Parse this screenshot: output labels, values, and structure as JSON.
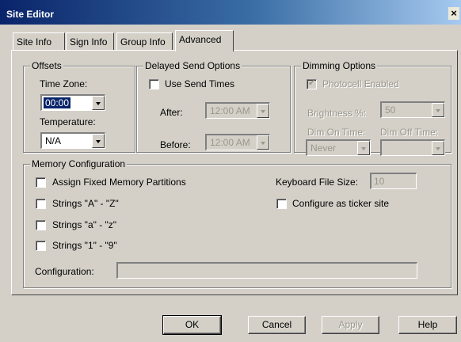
{
  "window": {
    "title": "Site Editor",
    "close_glyph": "×"
  },
  "tabs": [
    {
      "label": "Site Info"
    },
    {
      "label": "Sign Info"
    },
    {
      "label": "Group Info"
    },
    {
      "label": "Advanced",
      "active": true
    }
  ],
  "offsets": {
    "title": "Offsets",
    "time_zone_label": "Time Zone:",
    "time_zone_value": "00:00",
    "temperature_label": "Temperature:",
    "temperature_value": "N/A"
  },
  "delayed_send": {
    "title": "Delayed Send Options",
    "use_send_times_label": "Use Send Times",
    "use_send_times_checked": false,
    "after_label": "After:",
    "after_value": "12:00 AM",
    "before_label": "Before:",
    "before_value": "12:00 AM"
  },
  "dimming": {
    "title": "Dimming Options",
    "photocell_label": "Photocell Enabled",
    "photocell_checked": true,
    "brightness_label": "Brightness %:",
    "brightness_value": "50",
    "dim_on_label": "Dim On Time:",
    "dim_on_value": "Never",
    "dim_off_label": "Dim Off Time:",
    "dim_off_value": ""
  },
  "memory": {
    "title": "Memory Configuration",
    "assign_fixed_label": "Assign Fixed Memory Partitions",
    "strings_upper_label": "Strings \"A\" - \"Z\"",
    "strings_lower_label": "Strings \"a\" - \"z\"",
    "strings_digits_label": "Strings \"1\" - \"9\"",
    "keyboard_file_size_label": "Keyboard File Size:",
    "keyboard_file_size_value": "10",
    "ticker_site_label": "Configure as ticker site",
    "configuration_label": "Configuration:",
    "configuration_value": ""
  },
  "buttons": {
    "ok": "OK",
    "cancel": "Cancel",
    "apply": "Apply",
    "help": "Help"
  },
  "icons": {
    "check": "✔"
  }
}
